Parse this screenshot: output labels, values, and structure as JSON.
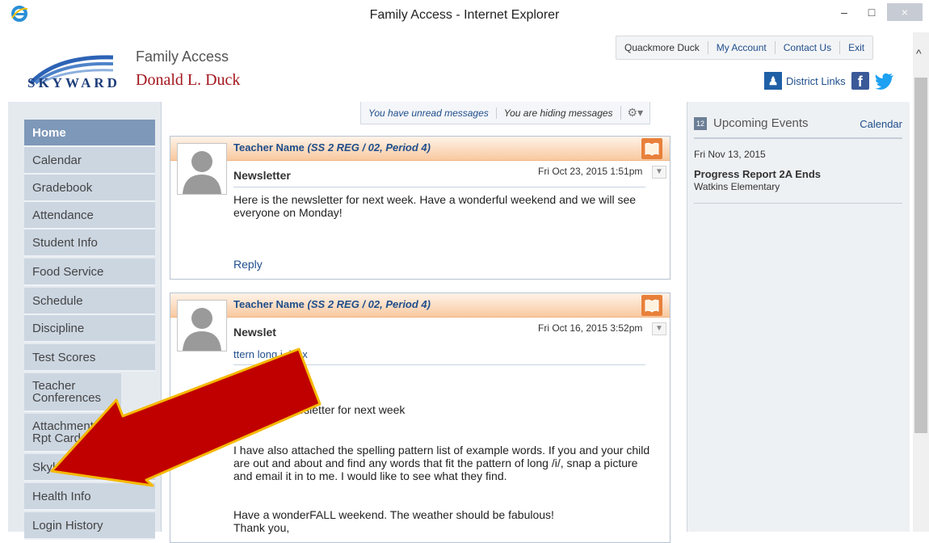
{
  "window": {
    "title": "Family Access - Internet Explorer",
    "minimize": "–",
    "maximize": "□",
    "close": "×"
  },
  "header": {
    "logo_text": "SKYWARD",
    "app_name": "Family Access",
    "student_name": "Donald L. Duck",
    "topnav": [
      "Quackmore Duck",
      "My Account",
      "Contact Us",
      "Exit"
    ],
    "district_links": "District Links"
  },
  "sidebar": {
    "items": [
      {
        "label": "Home",
        "active": true
      },
      {
        "label": "Calendar"
      },
      {
        "label": "Gradebook"
      },
      {
        "label": "Attendance"
      },
      {
        "label": "Student Info"
      },
      {
        "label": "Food Service"
      },
      {
        "label": "Schedule"
      },
      {
        "label": "Discipline"
      },
      {
        "label": "Test Scores"
      },
      {
        "label": "Teacher Conferences"
      },
      {
        "label": "Attachments Rpt Cards"
      },
      {
        "label": "Skylert"
      },
      {
        "label": "Health Info"
      },
      {
        "label": "Login History"
      }
    ]
  },
  "messages_bar": {
    "unread": "You have unread messages",
    "hiding": "You are hiding messages"
  },
  "messages": [
    {
      "from": "Teacher Name",
      "class": "(SS 2 REG / 02, Period 4)",
      "date": "Fri Oct 23, 2015 1:51pm",
      "subject": "Newsletter",
      "body": "Here is the newsletter for next week.  Have a wonderful weekend and we will see everyone on Monday!",
      "reply": "Reply"
    },
    {
      "from": "Teacher Name",
      "class": "(SS 2 REG / 02, Period 4)",
      "date": "Fri Oct 16, 2015 3:52pm",
      "subject": "Newslet",
      "attachment": "ttern long i.docx",
      "greeting": "oon,",
      "line1": "ere is the newsletter for next week",
      "para2": "I have also attached the spelling pattern list of example words.  If you and your child are out and about and find any words that fit the pattern of long /i/, snap a picture and email it in to me.  I would like to see what they find.",
      "para3a": "Have a wonderFALL weekend.  The weather should be fabulous!",
      "para3b": "Thank you,"
    }
  ],
  "events": {
    "title": "Upcoming Events",
    "calendar_link": "Calendar",
    "icon_text": "12",
    "date": "Fri Nov 13, 2015",
    "name": "Progress Report 2A Ends",
    "school": "Watkins Elementary"
  },
  "colors": {
    "accent_blue": "#1f4e8c",
    "student_red": "#a3171e",
    "card_orange": "#f8c9a0",
    "arrow_red": "#c00000",
    "arrow_outline": "#f5b800"
  }
}
